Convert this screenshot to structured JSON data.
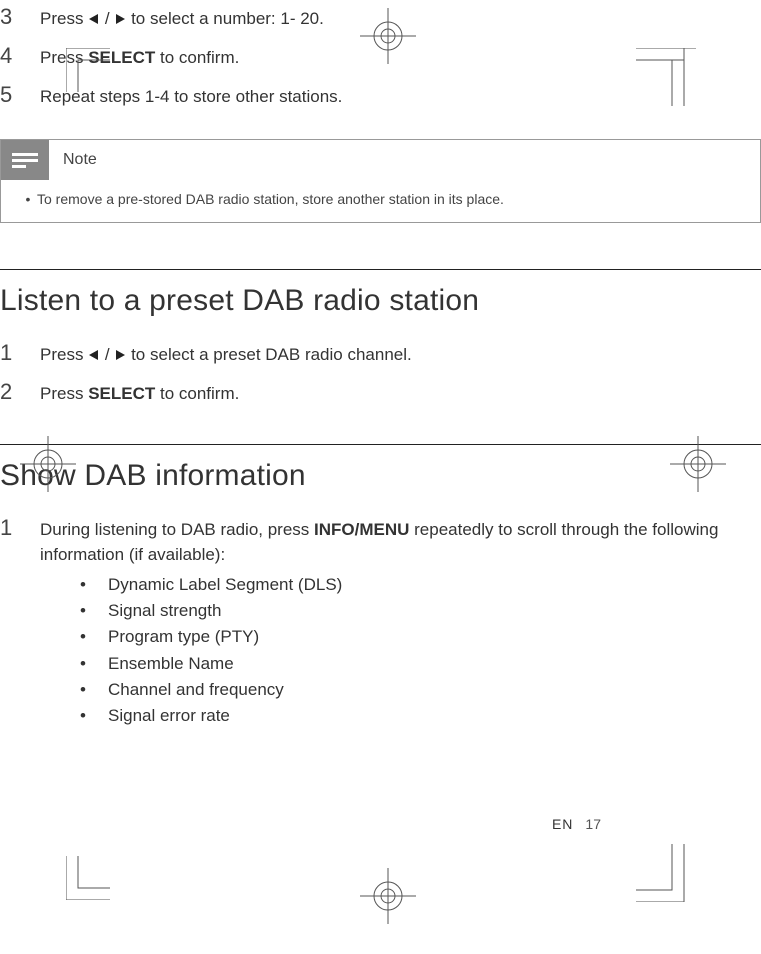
{
  "topSteps": [
    {
      "num": "3",
      "pre": "Press ",
      "post": " to select a number: 1- 20.",
      "arrows": true,
      "bold": null
    },
    {
      "num": "4",
      "pre": "Press ",
      "post": " to confirm.",
      "arrows": false,
      "bold": "SELECT"
    },
    {
      "num": "5",
      "pre": "Repeat steps 1-4 to store other stations.",
      "post": "",
      "arrows": false,
      "bold": null
    }
  ],
  "note": {
    "label": "Note",
    "text": "To remove a pre-stored DAB radio station, store another station in its place."
  },
  "section1": {
    "title": "Listen to a preset DAB radio station",
    "steps": [
      {
        "num": "1",
        "pre": "Press ",
        "post": " to select a preset DAB radio channel.",
        "arrows": true,
        "bold": null
      },
      {
        "num": "2",
        "pre": "Press ",
        "post": " to confirm.",
        "arrows": false,
        "bold": "SELECT"
      }
    ]
  },
  "section2": {
    "title": "Show DAB information",
    "step": {
      "num": "1",
      "pre": "During listening to DAB radio, press ",
      "bold": "INFO/MENU",
      "post": " repeatedly to scroll through the following information (if available):"
    },
    "bullets": [
      "Dynamic Label Segment (DLS)",
      "Signal strength",
      "Program type (PTY)",
      "Ensemble Name",
      "Channel and frequency",
      "Signal error rate"
    ]
  },
  "footer": {
    "lang": "EN",
    "page": "17"
  }
}
